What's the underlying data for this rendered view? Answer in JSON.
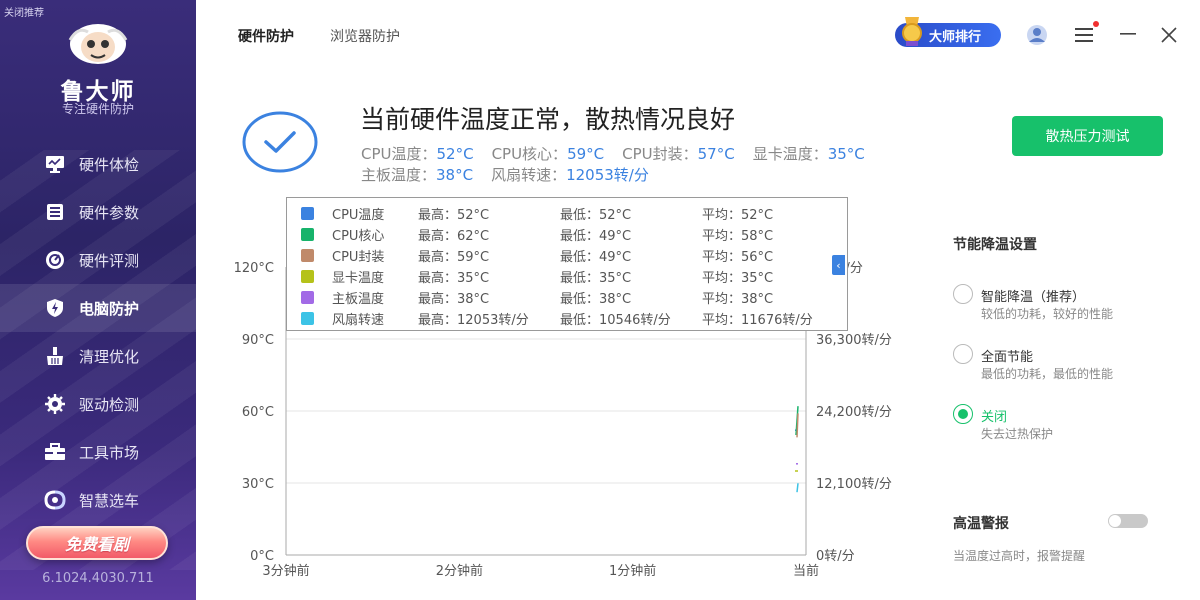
{
  "sidebar": {
    "close_recommend": "关闭推荐",
    "brand": "鲁大师",
    "brand_sub": "专注硬件防护",
    "items": [
      {
        "label": "硬件体检",
        "icon": "monitor-icon"
      },
      {
        "label": "硬件参数",
        "icon": "list-icon"
      },
      {
        "label": "硬件评测",
        "icon": "gauge-icon"
      },
      {
        "label": "电脑防护",
        "icon": "shield-bolt-icon"
      },
      {
        "label": "清理优化",
        "icon": "broom-icon"
      },
      {
        "label": "驱动检测",
        "icon": "gear-icon"
      },
      {
        "label": "工具市场",
        "icon": "toolbox-icon"
      },
      {
        "label": "智慧选车",
        "icon": "car-brand-icon"
      }
    ],
    "active_index": 3,
    "free_button": "免费看剧",
    "version": "6.1024.4030.711"
  },
  "top_tabs": [
    "硬件防护",
    "浏览器防护"
  ],
  "header": {
    "rank_button": "大师排行"
  },
  "status": {
    "headline": "当前硬件温度正常，散热情况良好",
    "readouts": [
      {
        "label": "CPU温度：",
        "value": "52°C"
      },
      {
        "label": "CPU核心：",
        "value": "59°C"
      },
      {
        "label": "CPU封装：",
        "value": "57°C"
      },
      {
        "label": "显卡温度：",
        "value": "35°C"
      },
      {
        "label": "主板温度：",
        "value": "38°C"
      },
      {
        "label": "风扇转速：",
        "value": "12053转/分"
      }
    ],
    "stress_button": "散热压力测试"
  },
  "chart_data": {
    "type": "line",
    "x_labels": [
      "3分钟前",
      "2分钟前",
      "1分钟前",
      "当前"
    ],
    "y_left_ticks": [
      "0°C",
      "30°C",
      "60°C",
      "90°C",
      "120°C"
    ],
    "y_right_ticks": [
      "0转/分",
      "12,100转/分",
      "24,200转/分",
      "36,300转/分",
      "00转/分"
    ],
    "ylim_left": [
      0,
      120
    ],
    "ylim_right": [
      0,
      48400
    ],
    "legend": [
      {
        "name": "CPU温度",
        "color": "#3b82e0",
        "max": "最高：52°C",
        "min": "最低：52°C",
        "avg": "平均：52°C"
      },
      {
        "name": "CPU核心",
        "color": "#17b36b",
        "max": "最高：62°C",
        "min": "最低：49°C",
        "avg": "平均：58°C"
      },
      {
        "name": "CPU封装",
        "color": "#c08a6a",
        "max": "最高：59°C",
        "min": "最低：49°C",
        "avg": "平均：56°C"
      },
      {
        "name": "显卡温度",
        "color": "#b5c21a",
        "max": "最高：35°C",
        "min": "最低：35°C",
        "avg": "平均：35°C"
      },
      {
        "name": "主板温度",
        "color": "#a26ae6",
        "max": "最高：38°C",
        "min": "最低：38°C",
        "avg": "平均：38°C"
      },
      {
        "name": "风扇转速",
        "color": "#3cc3e6",
        "max": "最高：12053转/分",
        "min": "最低：10546转/分",
        "avg": "平均：11676转/分"
      }
    ],
    "series": [
      {
        "name": "CPU温度",
        "axis": "left",
        "values": [
          52,
          52
        ]
      },
      {
        "name": "CPU核心",
        "axis": "left",
        "values": [
          50,
          62
        ]
      },
      {
        "name": "CPU封装",
        "axis": "left",
        "values": [
          49,
          59
        ]
      },
      {
        "name": "显卡温度",
        "axis": "left",
        "values": [
          35,
          35
        ]
      },
      {
        "name": "主板温度",
        "axis": "left",
        "values": [
          38,
          38
        ]
      },
      {
        "name": "风扇转速",
        "axis": "right",
        "values": [
          10546,
          12053
        ]
      }
    ]
  },
  "settings": {
    "title": "节能降温设置",
    "options": [
      {
        "label": "智能降温（推荐）",
        "desc": "较低的功耗，较好的性能",
        "selected": false
      },
      {
        "label": "全面节能",
        "desc": "最低的功耗，最低的性能",
        "selected": false
      },
      {
        "label": "关闭",
        "desc": "失去过热保护",
        "selected": true
      }
    ],
    "alarm_title": "高温警报",
    "alarm_on": false,
    "alarm_desc": "当温度过高时，报警提醒"
  }
}
